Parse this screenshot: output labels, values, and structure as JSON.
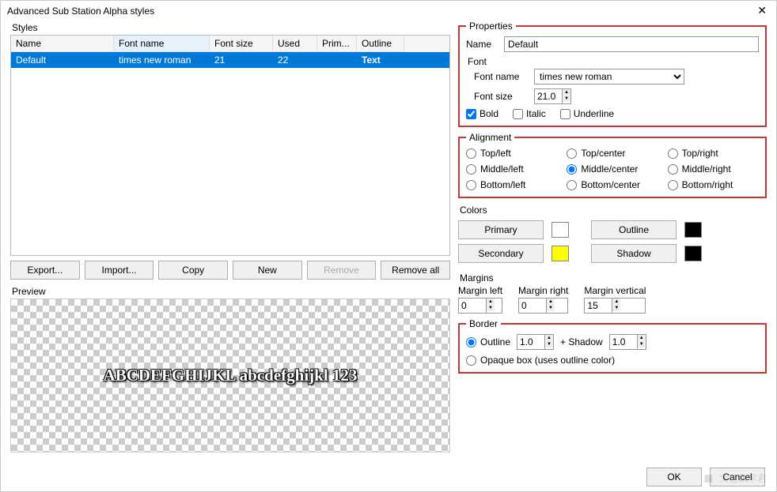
{
  "window": {
    "title": "Advanced Sub Station Alpha styles"
  },
  "styles_section": {
    "legend": "Styles",
    "columns": [
      "Name",
      "Font name",
      "Font size",
      "Used",
      "Prim...",
      "Outline"
    ],
    "rows": [
      {
        "name": "Default",
        "font_name": "times new roman",
        "font_size": "21",
        "used": "22",
        "primary": "",
        "outline": "Text"
      }
    ],
    "buttons": {
      "export": "Export...",
      "import": "Import...",
      "copy": "Copy",
      "new": "New",
      "remove": "Remove",
      "remove_all": "Remove all"
    }
  },
  "preview": {
    "legend": "Preview",
    "text": "ABCDEFGHIJKL abcdefghijkl 123"
  },
  "properties": {
    "legend": "Properties",
    "name_label": "Name",
    "name_value": "Default",
    "font_legend": "Font",
    "font_name_label": "Font name",
    "font_name_value": "times new roman",
    "font_size_label": "Font size",
    "font_size_value": "21.0",
    "bold_label": "Bold",
    "bold_checked": true,
    "italic_label": "Italic",
    "italic_checked": false,
    "underline_label": "Underline",
    "underline_checked": false
  },
  "alignment": {
    "legend": "Alignment",
    "options": [
      "Top/left",
      "Top/center",
      "Top/right",
      "Middle/left",
      "Middle/center",
      "Middle/right",
      "Bottom/left",
      "Bottom/center",
      "Bottom/right"
    ],
    "selected": "Middle/center"
  },
  "colors": {
    "legend": "Colors",
    "primary_label": "Primary",
    "primary_swatch": "#ffffff",
    "outline_label": "Outline",
    "outline_swatch": "#000000",
    "secondary_label": "Secondary",
    "secondary_swatch": "#ffff00",
    "shadow_label": "Shadow",
    "shadow_swatch": "#000000"
  },
  "margins": {
    "legend": "Margins",
    "left_label": "Margin left",
    "left_value": "0",
    "right_label": "Margin right",
    "right_value": "0",
    "vertical_label": "Margin vertical",
    "vertical_value": "15"
  },
  "border": {
    "legend": "Border",
    "outline_label": "Outline",
    "outline_value": "1.0",
    "shadow_label": "+ Shadow",
    "shadow_value": "1.0",
    "opaque_label": "Opaque box (uses outline color)",
    "selected": "outline"
  },
  "footer": {
    "ok": "OK",
    "cancel": "Cancel"
  },
  "watermark": "文艺数学君"
}
